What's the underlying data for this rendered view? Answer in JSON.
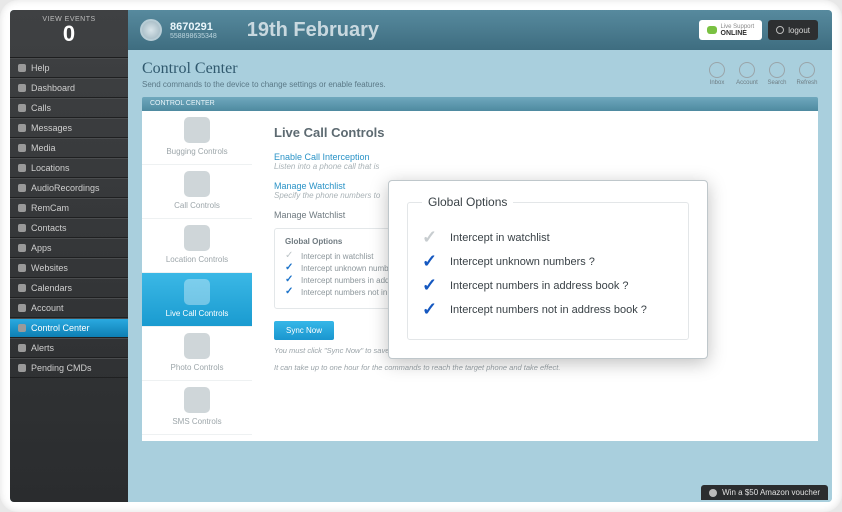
{
  "sidebar": {
    "events_label": "VIEW EVENTS",
    "events_count": "0",
    "items": [
      {
        "label": "Help"
      },
      {
        "label": "Dashboard"
      },
      {
        "label": "Calls"
      },
      {
        "label": "Messages"
      },
      {
        "label": "Media"
      },
      {
        "label": "Locations"
      },
      {
        "label": "AudioRecordings"
      },
      {
        "label": "RemCam"
      },
      {
        "label": "Contacts"
      },
      {
        "label": "Apps"
      },
      {
        "label": "Websites"
      },
      {
        "label": "Calendars"
      },
      {
        "label": "Account"
      },
      {
        "label": "Control Center"
      },
      {
        "label": "Alerts"
      },
      {
        "label": "Pending CMDs"
      }
    ],
    "active_index": 13
  },
  "header": {
    "account_id": "8670291",
    "account_sub": "558898635348",
    "date": "19th February",
    "support_label": "Live Support",
    "support_status": "ONLINE",
    "logout": "logout"
  },
  "cc": {
    "title": "Control Center",
    "subtitle": "Send commands to the device to change settings or enable features.",
    "bar": "CONTROL CENTER",
    "top_icons": [
      {
        "label": "Inbox"
      },
      {
        "label": "Account"
      },
      {
        "label": "Search"
      },
      {
        "label": "Refresh"
      }
    ]
  },
  "subnav": {
    "items": [
      {
        "label": "Bugging Controls"
      },
      {
        "label": "Call Controls"
      },
      {
        "label": "Location Controls"
      },
      {
        "label": "Live Call Controls"
      },
      {
        "label": "Photo Controls"
      },
      {
        "label": "SMS Controls"
      }
    ],
    "active_index": 3
  },
  "main": {
    "heading": "Live Call Controls",
    "enable_link": "Enable Call Interception",
    "enable_hint": "Listen into a phone call that is",
    "manage_link": "Manage Watchlist",
    "manage_hint": "Specify the phone numbers to",
    "section_title": "Manage Watchlist",
    "gobox_title": "Global Options",
    "options": [
      {
        "label": "Intercept in watchlist",
        "on": false
      },
      {
        "label": "Intercept unknown numbers",
        "on": true
      },
      {
        "label": "Intercept numbers in address",
        "on": true
      },
      {
        "label": "Intercept numbers not in address",
        "on": true
      }
    ],
    "sync_btn": "Sync Now",
    "note1": "You must click \"Sync Now\" to save your settings.",
    "note2": "It can take up to one hour for the commands to reach the target phone and take effect."
  },
  "modal": {
    "title": "Global Options",
    "rows": [
      {
        "label": "Intercept in watchlist",
        "on": false
      },
      {
        "label": "Intercept unknown numbers ?",
        "on": true
      },
      {
        "label": "Intercept numbers in address book ?",
        "on": true
      },
      {
        "label": "Intercept numbers not in address book ?",
        "on": true
      }
    ]
  },
  "promo": {
    "text": "Win a $50 Amazon voucher"
  }
}
